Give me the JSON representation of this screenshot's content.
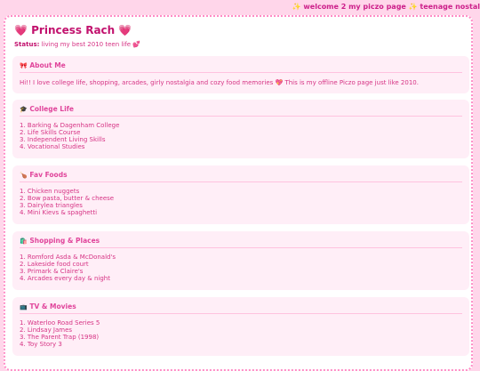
{
  "marquee": "✨ welcome 2 my piczo page ✨ teenage nostal",
  "profile": {
    "title": "💗 Princess Rach 💗",
    "status_label": "Status:",
    "status_text": "living my best 2010 teen life 💕"
  },
  "sections": [
    {
      "icon": "🎀",
      "heading": "About Me",
      "text": "Hi!! I love college life, shopping, arcades, girly nostalgia and cozy food memories 💖 This is my offline Piczo page just like 2010."
    },
    {
      "icon": "🎓",
      "heading": "College Life",
      "items": [
        "1. Barking & Dagenham College",
        "2. Life Skills Course",
        "3. Independent Living Skills",
        "4. Vocational Studies"
      ]
    },
    {
      "icon": "🍗",
      "heading": "Fav Foods",
      "items": [
        "1. Chicken nuggets",
        "2. Bow pasta, butter & cheese",
        "3. Dairylea triangles",
        "4. Mini Kievs & spaghetti"
      ]
    },
    {
      "icon": "🛍️",
      "heading": "Shopping & Places",
      "items": [
        "1. Romford Asda & McDonald's",
        "2. Lakeside food court",
        "3. Primark & Claire's",
        "4. Arcades every day & night"
      ]
    },
    {
      "icon": "📺",
      "heading": "TV & Movies",
      "items": [
        "1. Waterloo Road Series 5",
        "2. Lindsay James",
        "3. The Parent Trap (1998)",
        "4. Toy Story 3"
      ]
    }
  ]
}
